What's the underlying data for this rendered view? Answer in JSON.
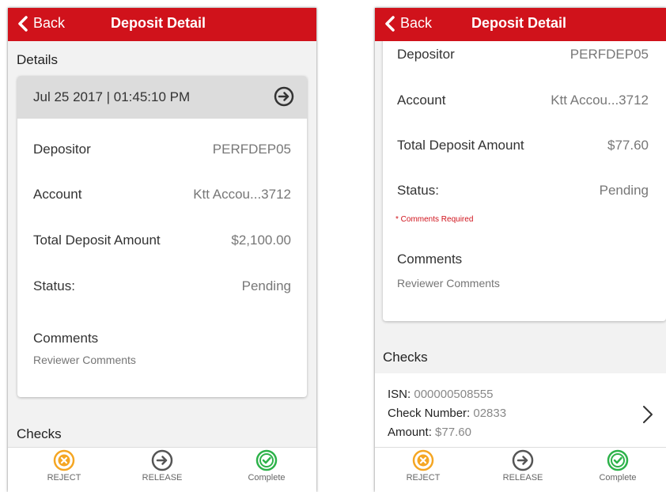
{
  "colors": {
    "brand": "#d0121b",
    "reject": "#f5a623",
    "release": "#555555",
    "complete": "#2db24a"
  },
  "left": {
    "header": {
      "back_label": "Back",
      "title": "Deposit Detail"
    },
    "details_label": "Details",
    "date": "Jul 25 2017 | 01:45:10 PM",
    "rows": [
      {
        "label": "Depositor",
        "value": "PERFDEP05"
      },
      {
        "label": "Account",
        "value": "Ktt Accou...3712"
      },
      {
        "label": "Total Deposit Amount",
        "value": "$2,100.00"
      },
      {
        "label": "Status:",
        "value": "Pending"
      }
    ],
    "comments_label": "Comments",
    "comments_placeholder": "Reviewer Comments",
    "checks_label": "Checks"
  },
  "right": {
    "header": {
      "back_label": "Back",
      "title": "Deposit Detail"
    },
    "rows": [
      {
        "label": "Depositor",
        "value": "PERFDEP05"
      },
      {
        "label": "Account",
        "value": "Ktt Accou...3712"
      },
      {
        "label": "Total Deposit Amount",
        "value": "$77.60"
      },
      {
        "label": "Status:",
        "value": "Pending"
      }
    ],
    "required_note": "* Comments Required",
    "comments_label": "Comments",
    "comments_placeholder": "Reviewer Comments",
    "checks_label": "Checks",
    "check": {
      "isn_label": "ISN:",
      "isn_value": "000000508555",
      "number_label": "Check Number:",
      "number_value": "02833",
      "amount_label": "Amount:",
      "amount_value": "$77.60"
    }
  },
  "footer": {
    "reject": "REJECT",
    "release": "RELEASE",
    "complete": "Complete"
  },
  "icons": {
    "back": "chevron-left-icon",
    "arrow": "arrow-right-circle-icon",
    "reject": "x-circle-icon",
    "release": "arrow-right-circle-icon",
    "complete": "check-circle-icon"
  }
}
